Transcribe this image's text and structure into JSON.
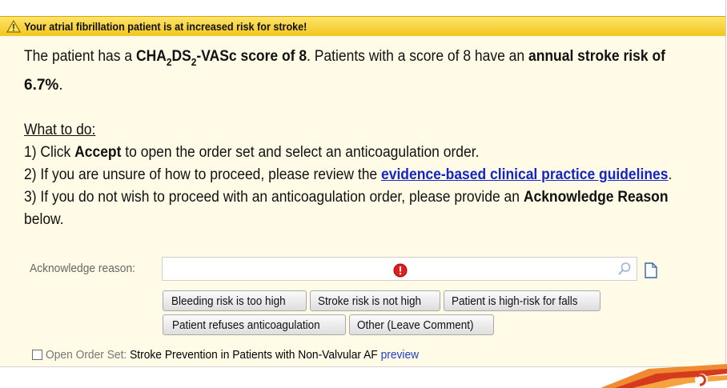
{
  "alert": {
    "title": "Your atrial fibrillation patient is at increased risk for stroke!",
    "icon": "warning-icon",
    "color": "#f7d23a"
  },
  "message": {
    "score_intro": "The patient has a ",
    "score_cha": "CHA",
    "score_sub2": "2",
    "score_ds": "DS",
    "score_sub2b": "2",
    "score_tail": "-VASc score of 8",
    "score_after": ".  Patients with a score of 8 have an ",
    "risk_label": "annual stroke risk of",
    "risk_value": "6.7%",
    "risk_end": "."
  },
  "instructions": {
    "heading": "What to do:",
    "step1_pre": "1) Click ",
    "step1_bold": "Accept",
    "step1_post": " to open the order set and select an anticoagulation order.",
    "step2_pre": "2) If you are unsure of how to proceed, please review the ",
    "step2_link": "evidence-based clinical practice guidelines",
    "step2_post": ".",
    "step3_pre": "3) If you do not wish to proceed with an anticoagulation order, please provide an ",
    "step3_bold": "Acknowledge Reason",
    "step3_end": "below."
  },
  "acknowledge": {
    "label": "Acknowledge reason:",
    "value": "",
    "reasons": [
      "Bleeding risk is too high",
      "Stroke risk is not high",
      "Patient is high-risk for falls",
      "Patient refuses anticoagulation",
      "Other (Leave Comment)"
    ]
  },
  "order_set": {
    "label": "Open Order Set:",
    "name": "Stroke Prevention in Patients with Non-Valvular AF",
    "preview": "preview",
    "checked": false
  },
  "colors": {
    "content_bg": "#fffbe7",
    "link": "#1326c4",
    "required": "#e02020"
  }
}
